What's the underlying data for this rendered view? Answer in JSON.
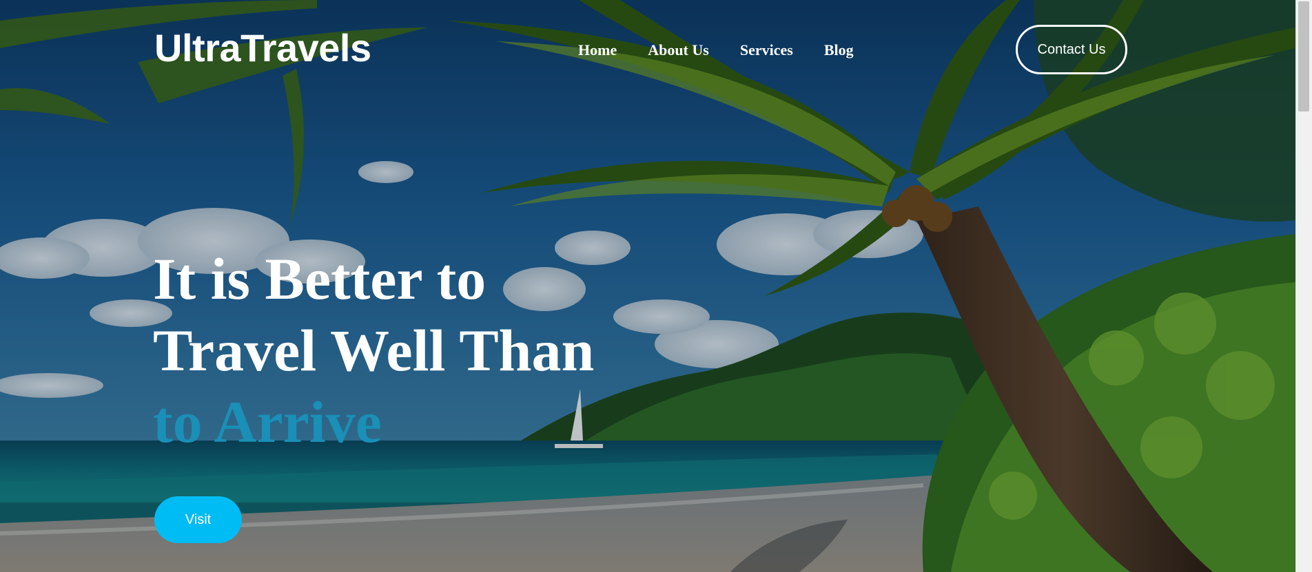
{
  "brand": {
    "name": "UltraTravels"
  },
  "nav": {
    "links": [
      {
        "label": "Home"
      },
      {
        "label": "About Us"
      },
      {
        "label": "Services"
      },
      {
        "label": "Blog"
      }
    ],
    "contact_label": "Contact Us"
  },
  "hero": {
    "headline_line1": "It is Better to",
    "headline_line2": "Travel Well Than",
    "headline_line3": "to Arrive",
    "cta_label": "Visit",
    "background_icon": "tropical-beach-palm-photo"
  },
  "colors": {
    "accent_text": "#1a8fb7",
    "cta_button": "#00bcf5",
    "text": "#ffffff"
  }
}
